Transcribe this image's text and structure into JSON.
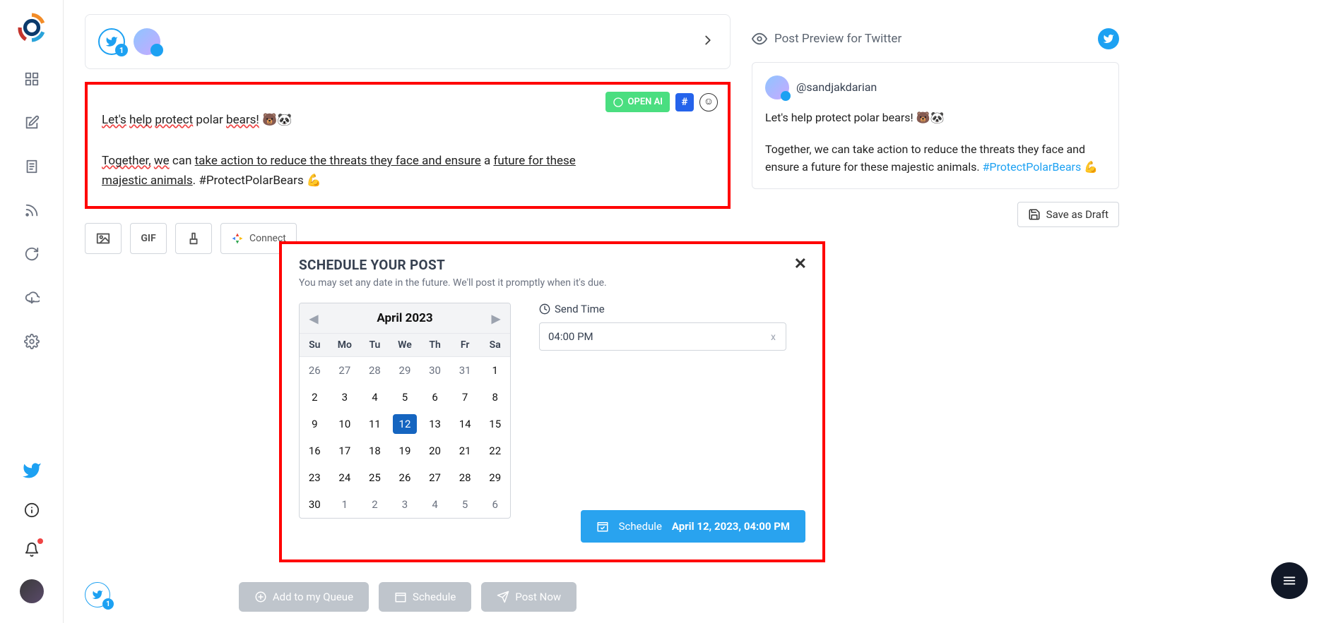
{
  "sidebar": {
    "items": [
      "dashboard",
      "compose",
      "document",
      "rss",
      "refresh",
      "download",
      "settings"
    ]
  },
  "account_badge_count": "1",
  "compose": {
    "openai_label": "OPEN AI",
    "text_line1_prefix": "Let's",
    "text_line1_w2": "help",
    "text_line1_w3": "protect",
    "text_line1_rest": "polar",
    "text_line1_w5": "bears!",
    "text_line1_emoji": "🐻🐼",
    "text_line2_p1": "Together,",
    "text_line2_p2": "we",
    "text_line2_p3": "can",
    "text_line2_p4": "take action to reduce the threats they face and ensure",
    "text_line2_p5": "a",
    "text_line2_p6": "future for these",
    "text_line3_p1": "majestic animals",
    "text_line3_hash": ". #ProtectPolarBears 💪"
  },
  "attach": {
    "gif": "GIF",
    "connect": "Connect"
  },
  "modal": {
    "title": "SCHEDULE YOUR POST",
    "subtitle": "You may set any date in the future. We'll post it promptly when it's due.",
    "month": "April 2023",
    "dow": [
      "Su",
      "Mo",
      "Tu",
      "We",
      "Th",
      "Fr",
      "Sa"
    ],
    "weeks": [
      [
        {
          "d": "26",
          "m": true
        },
        {
          "d": "27",
          "m": true
        },
        {
          "d": "28",
          "m": true
        },
        {
          "d": "29",
          "m": true
        },
        {
          "d": "30",
          "m": true
        },
        {
          "d": "31",
          "m": true
        },
        {
          "d": "1"
        }
      ],
      [
        {
          "d": "2"
        },
        {
          "d": "3"
        },
        {
          "d": "4"
        },
        {
          "d": "5"
        },
        {
          "d": "6"
        },
        {
          "d": "7"
        },
        {
          "d": "8"
        }
      ],
      [
        {
          "d": "9"
        },
        {
          "d": "10"
        },
        {
          "d": "11"
        },
        {
          "d": "12",
          "sel": true
        },
        {
          "d": "13"
        },
        {
          "d": "14"
        },
        {
          "d": "15"
        }
      ],
      [
        {
          "d": "16"
        },
        {
          "d": "17"
        },
        {
          "d": "18"
        },
        {
          "d": "19"
        },
        {
          "d": "20"
        },
        {
          "d": "21"
        },
        {
          "d": "22"
        }
      ],
      [
        {
          "d": "23"
        },
        {
          "d": "24"
        },
        {
          "d": "25"
        },
        {
          "d": "26"
        },
        {
          "d": "27"
        },
        {
          "d": "28"
        },
        {
          "d": "29"
        }
      ],
      [
        {
          "d": "30"
        },
        {
          "d": "1",
          "m": true
        },
        {
          "d": "2",
          "m": true
        },
        {
          "d": "3",
          "m": true
        },
        {
          "d": "4",
          "m": true
        },
        {
          "d": "5",
          "m": true
        },
        {
          "d": "6",
          "m": true
        }
      ]
    ],
    "send_time_label": "Send Time",
    "send_time_value": "04:00 PM",
    "schedule_label": "Schedule",
    "schedule_datetime": "April 12, 2023, 04:00 PM"
  },
  "preview": {
    "header": "Post Preview for Twitter",
    "handle": "@sandjakdarian",
    "line1": "Let's help protect polar bears! 🐻🐼",
    "line2_a": "Together, we can take action to reduce the threats they face and ensure a future for these majestic animals. ",
    "hashtag": "#ProtectPolarBears",
    "line2_b": " 💪",
    "save_draft": "Save as Draft"
  },
  "bottom": {
    "queue": "Add to my Queue",
    "schedule": "Schedule",
    "post_now": "Post Now",
    "badge": "1"
  }
}
